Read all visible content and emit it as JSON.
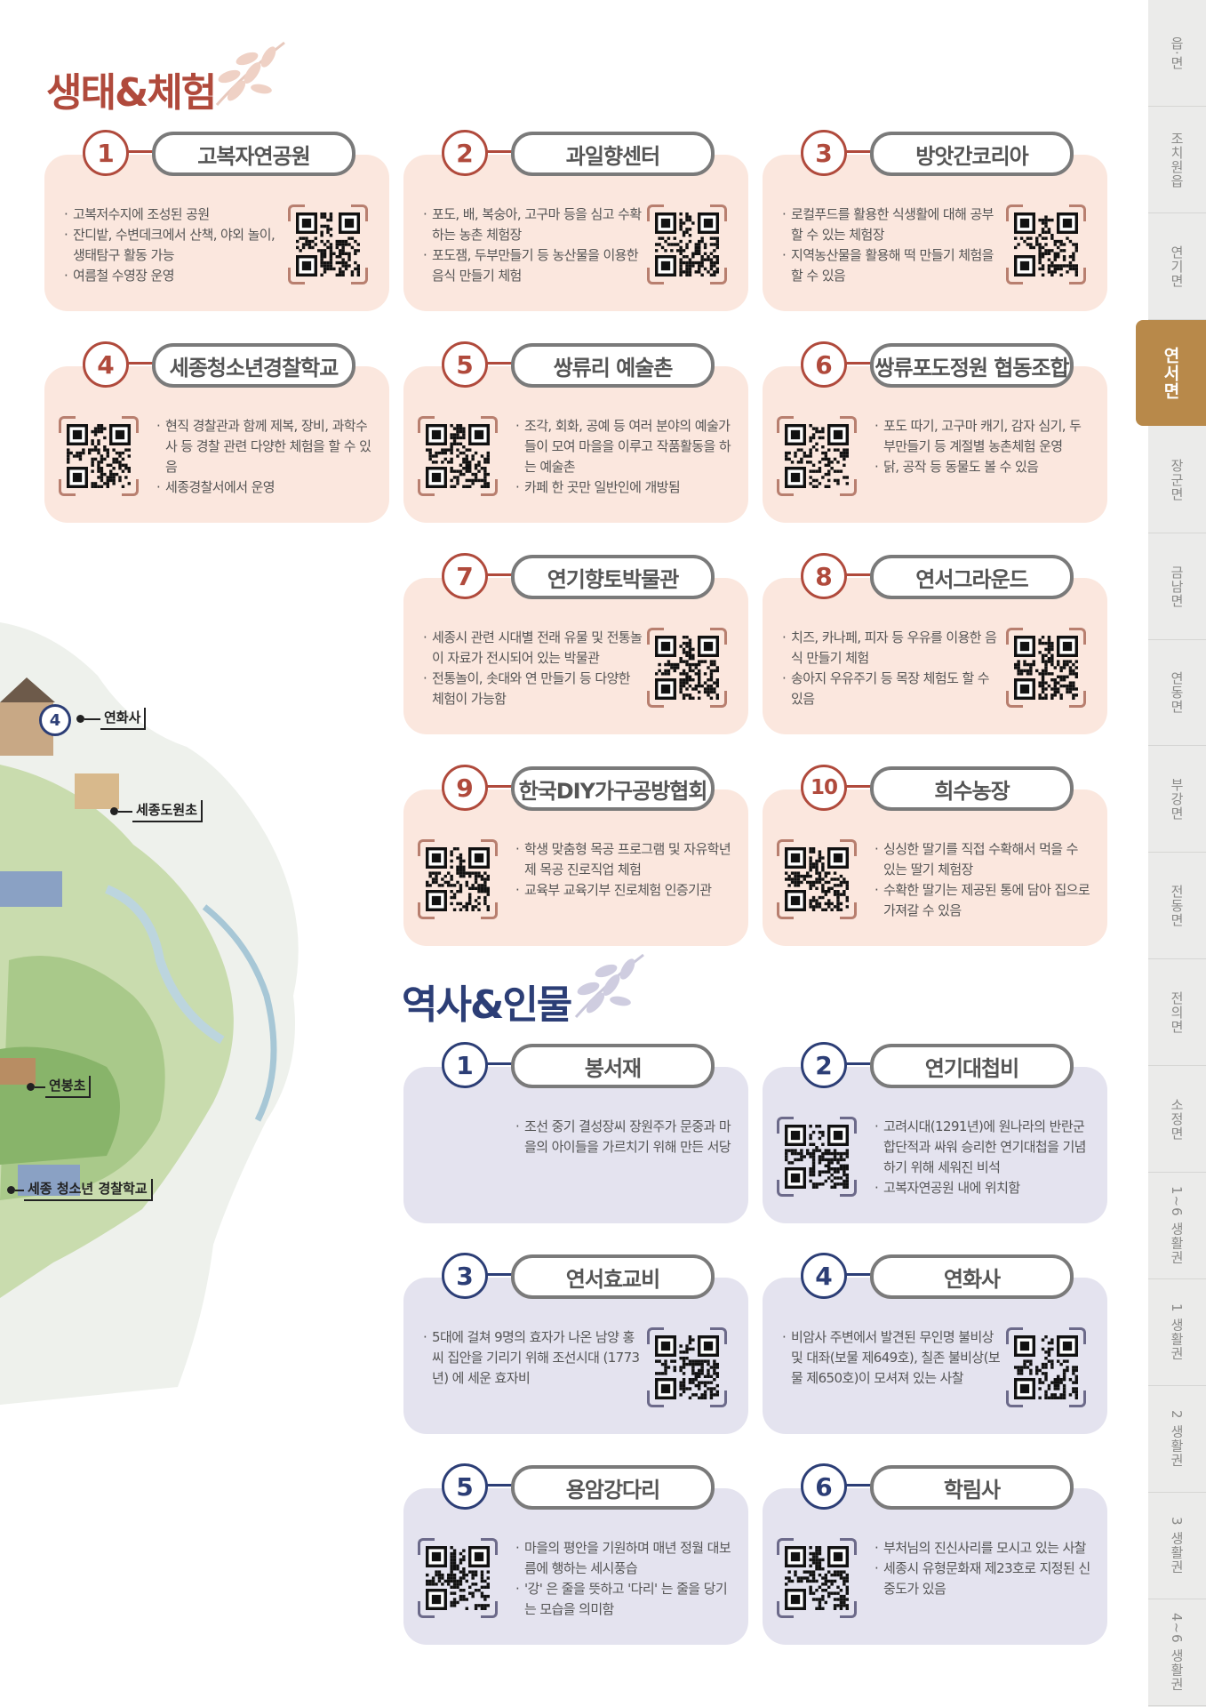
{
  "sections": {
    "eco_title": "생태&체험",
    "history_title": "역사&인물"
  },
  "colors": {
    "eco_accent": "#b04a3c",
    "history_accent": "#2c3e76",
    "eco_card_bg": "#fbe7de",
    "history_card_bg": "#e4e3ef",
    "active_tab": "#b8894a"
  },
  "tabs": [
    {
      "label": "읍·면",
      "active": false
    },
    {
      "label": "조치원읍",
      "active": false
    },
    {
      "label": "연기면",
      "active": false
    },
    {
      "label": "연서면",
      "active": true
    },
    {
      "label": "장군면",
      "active": false
    },
    {
      "label": "금남면",
      "active": false
    },
    {
      "label": "연동면",
      "active": false
    },
    {
      "label": "부강면",
      "active": false
    },
    {
      "label": "전동면",
      "active": false
    },
    {
      "label": "전의면",
      "active": false
    },
    {
      "label": "소정면",
      "active": false
    },
    {
      "label": "1~6 생활권",
      "active": false
    },
    {
      "label": "1 생활권",
      "active": false
    },
    {
      "label": "2 생활권",
      "active": false
    },
    {
      "label": "3 생활권",
      "active": false
    },
    {
      "label": "4~6 생활권",
      "active": false
    }
  ],
  "eco_cards": [
    {
      "num": "1",
      "title": "고복자연공원",
      "items": [
        "고복저수지에 조성된 공원",
        "잔디밭, 수변데크에서 산책, 야외 놀이, 생태탐구 활동 가능",
        "여름철 수영장 운영"
      ]
    },
    {
      "num": "2",
      "title": "과일향센터",
      "items": [
        "포도, 배, 복숭아, 고구마 등을 심고 수확하는 농촌 체험장",
        "포도잼, 두부만들기 등 농산물을 이용한 음식 만들기 체험"
      ]
    },
    {
      "num": "3",
      "title": "방앗간코리아",
      "items": [
        "로컬푸드를 활용한 식생활에 대해 공부할 수 있는 체험장",
        "지역농산물을 활용해 떡 만들기 체험을 할 수 있음"
      ]
    },
    {
      "num": "4",
      "title": "세종청소년경찰학교",
      "items": [
        "현직 경찰관과 함께 제복, 장비, 과학수사 등 경찰 관련 다양한 체험을 할 수 있음",
        "세종경찰서에서 운영"
      ]
    },
    {
      "num": "5",
      "title": "쌍류리 예술촌",
      "items": [
        "조각, 회화, 공예 등 여러 분야의 예술가들이 모여 마을을 이루고 작품활동을 하는 예술촌",
        "카페 한 곳만 일반인에 개방됨"
      ]
    },
    {
      "num": "6",
      "title": "쌍류포도정원 협동조합",
      "items": [
        "포도 따기, 고구마 캐기, 감자 심기, 두부만들기 등 계절별 농촌체험 운영",
        "닭, 공작 등 동물도 볼 수 있음"
      ]
    },
    {
      "num": "7",
      "title": "연기향토박물관",
      "items": [
        "세종시 관련 시대별 전래 유물 및 전통놀이 자료가 전시되어 있는 박물관",
        "전통놀이, 솟대와 연 만들기 등 다양한 체험이 가능함"
      ]
    },
    {
      "num": "8",
      "title": "연서그라운드",
      "items": [
        "치즈, 카나페, 피자 등 우유를 이용한 음식 만들기 체험",
        "송아지 우유주기 등 목장 체험도 할 수 있음"
      ]
    },
    {
      "num": "9",
      "title": "한국DIY가구공방협회",
      "items": [
        "학생 맞춤형 목공 프로그램 및 자유학년제 목공 진로직업 체험",
        "교육부 교육기부 진로체험 인증기관"
      ]
    },
    {
      "num": "10",
      "title": "희수농장",
      "items": [
        "싱싱한 딸기를 직접 수확해서 먹을 수 있는 딸기 체험장",
        "수확한 딸기는 제공된 통에 담아 집으로 가져갈 수 있음"
      ]
    }
  ],
  "history_cards": [
    {
      "num": "1",
      "title": "봉서재",
      "items": [
        "조선 중기 결성장씨 장원주가 문중과 마을의 아이들을 가르치기 위해 만든 서당"
      ]
    },
    {
      "num": "2",
      "title": "연기대첩비",
      "items": [
        "고려시대(1291년)에 원나라의 반란군 합단적과 싸워 승리한 연기대첩을 기념하기 위해 세워진 비석",
        "고복자연공원 내에 위치함"
      ]
    },
    {
      "num": "3",
      "title": "연서효교비",
      "items": [
        "5대에 걸쳐 9명의 효자가 나온 남양 홍씨 집안을 기리기 위해 조선시대 (1773년) 에 세운 효자비"
      ]
    },
    {
      "num": "4",
      "title": "연화사",
      "items": [
        "비암사 주변에서 발견된 무인명 불비상 및 대좌(보물 제649호), 칠존 불비상(보물 제650호)이 모셔져 있는 사찰"
      ]
    },
    {
      "num": "5",
      "title": "용암강다리",
      "items": [
        "마을의 평안을 기원하며 매년 정월 대보름에 행하는 세시풍습",
        "'강' 은 줄을 뜻하고 '다리' 는 줄을 당기는 모습을 의미함"
      ]
    },
    {
      "num": "6",
      "title": "학림사",
      "items": [
        "부처님의 진신사리를 모시고 있는 사찰",
        "세종시 유형문화재 제23호로 지정된 신중도가 있음"
      ]
    }
  ],
  "map": {
    "labels": [
      "연화사",
      "세종도원초",
      "연봉초",
      "세종 청소년 경찰학교"
    ],
    "marker_num": "4"
  }
}
